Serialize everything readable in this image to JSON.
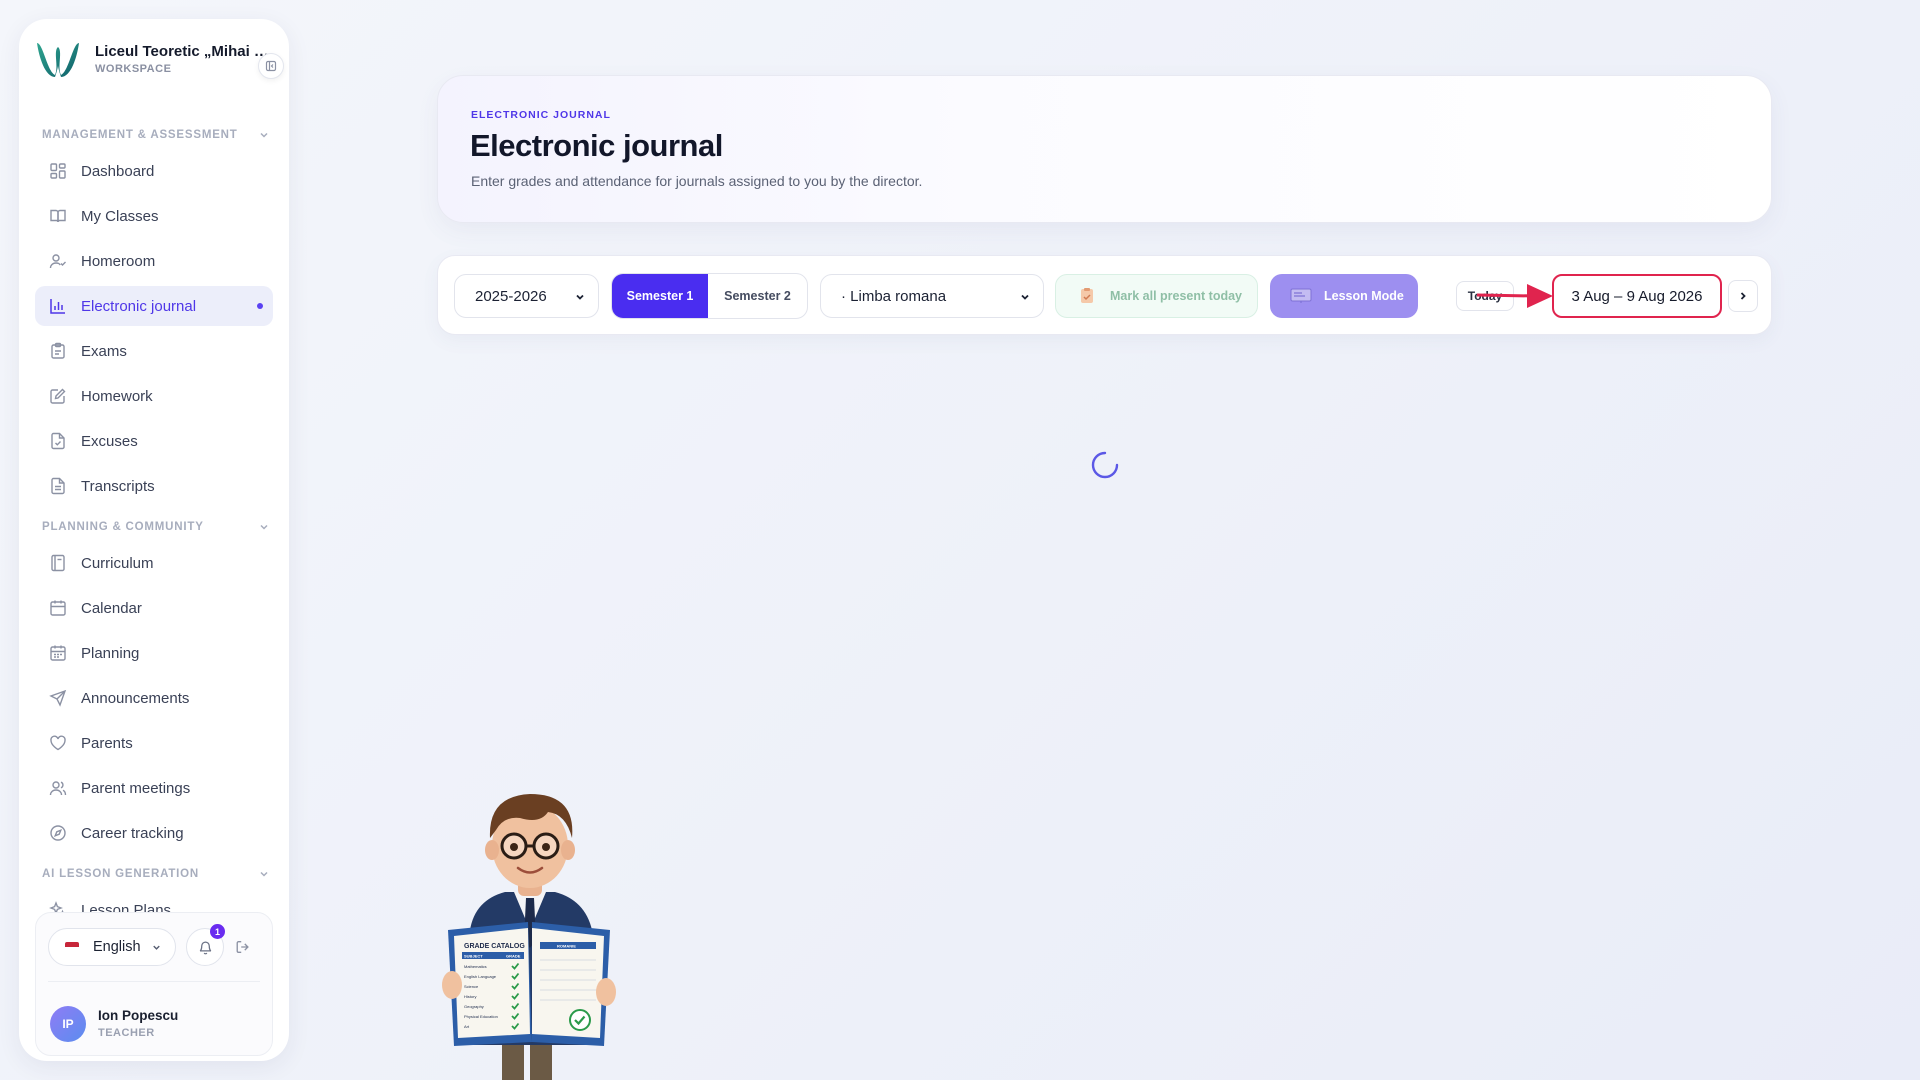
{
  "brand": {
    "name": "Liceul Teoretic „Mihai Emi...",
    "subtitle": "WORKSPACE"
  },
  "sidebar": {
    "sections": [
      {
        "label": "MANAGEMENT & ASSESSMENT"
      },
      {
        "label": "PLANNING & COMMUNITY"
      },
      {
        "label": "AI LESSON GENERATION"
      }
    ],
    "items": [
      {
        "label": "Dashboard",
        "icon": "grid-icon"
      },
      {
        "label": "My Classes",
        "icon": "book-open-icon"
      },
      {
        "label": "Homeroom",
        "icon": "user-check-icon"
      },
      {
        "label": "Electronic journal",
        "icon": "bar-chart-icon",
        "active": true
      },
      {
        "label": "Exams",
        "icon": "clipboard-icon"
      },
      {
        "label": "Homework",
        "icon": "edit-icon"
      },
      {
        "label": "Excuses",
        "icon": "file-check-icon"
      },
      {
        "label": "Transcripts",
        "icon": "file-text-icon"
      },
      {
        "label": "Curriculum",
        "icon": "book-icon"
      },
      {
        "label": "Calendar",
        "icon": "calendar-icon"
      },
      {
        "label": "Planning",
        "icon": "calendar-grid-icon"
      },
      {
        "label": "Announcements",
        "icon": "send-icon"
      },
      {
        "label": "Parents",
        "icon": "heart-icon"
      },
      {
        "label": "Parent meetings",
        "icon": "users-icon"
      },
      {
        "label": "Career tracking",
        "icon": "compass-icon"
      },
      {
        "label": "Lesson Plans",
        "icon": "sparkles-icon"
      }
    ]
  },
  "footer": {
    "language": "English",
    "notifications": "1",
    "user": {
      "initials": "IP",
      "name": "Ion Popescu",
      "role": "TEACHER"
    }
  },
  "header": {
    "eyebrow": "ELECTRONIC JOURNAL",
    "title": "Electronic journal",
    "subtitle": "Enter grades and attendance for journals assigned to you by the director."
  },
  "toolbar": {
    "year": "2025-2026",
    "semester1": "Semester 1",
    "semester2": "Semester 2",
    "subject": "· Limba romana",
    "mark_all": "Mark all present today",
    "lesson_mode": "Lesson Mode",
    "today": "Today",
    "date_range": "3 Aug – 9 Aug 2026"
  },
  "mascot": {
    "book_title": "GRADE CATALOG",
    "book_right_title": "ROMANIE",
    "col_subject": "SUBJECT",
    "col_grade": "GRADE",
    "subjects": [
      "Mathematics",
      "English Language",
      "Science",
      "History",
      "Geography",
      "Physical Education",
      "Art"
    ]
  },
  "colors": {
    "accent": "#4a2df0",
    "highlight": "#e0244e",
    "lesson": "#9d8ff0"
  }
}
